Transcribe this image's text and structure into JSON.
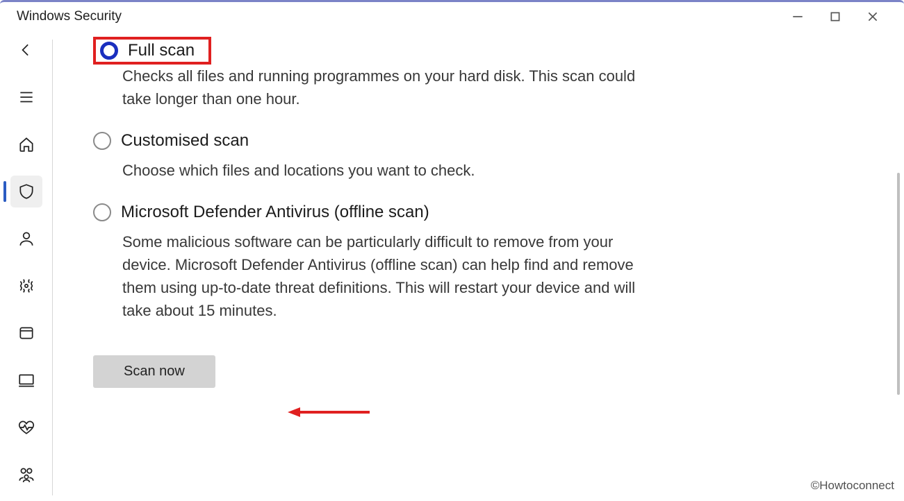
{
  "window": {
    "title": "Windows Security"
  },
  "sidebar": {
    "items": [
      {
        "name": "back"
      },
      {
        "name": "menu"
      },
      {
        "name": "home"
      },
      {
        "name": "shield",
        "active": true
      },
      {
        "name": "account"
      },
      {
        "name": "firewall"
      },
      {
        "name": "app-browser"
      },
      {
        "name": "device-security"
      },
      {
        "name": "device-performance"
      },
      {
        "name": "family"
      }
    ]
  },
  "scan_options": {
    "full": {
      "label": "Full scan",
      "desc": "Checks all files and running programmes on your hard disk. This scan could take longer than one hour."
    },
    "custom": {
      "label": "Customised scan",
      "desc": "Choose which files and locations you want to check."
    },
    "offline": {
      "label": "Microsoft Defender Antivirus (offline scan)",
      "desc": "Some malicious software can be particularly difficult to remove from your device. Microsoft Defender Antivirus (offline scan) can help find and remove them using up-to-date threat definitions. This will restart your device and will take about 15 minutes."
    }
  },
  "actions": {
    "scan_now": "Scan now"
  },
  "watermark": "©Howtoconnect"
}
